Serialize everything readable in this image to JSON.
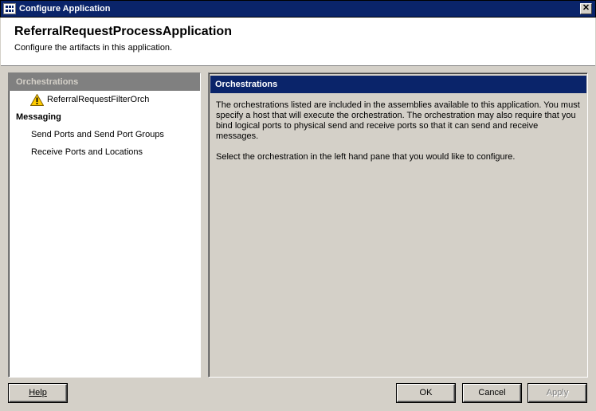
{
  "window": {
    "title": "Configure Application",
    "close_glyph": "✕"
  },
  "header": {
    "title": "ReferralRequestProcessApplication",
    "subtitle": "Configure the artifacts in this application."
  },
  "left_pane": {
    "section_header": "Orchestrations",
    "orchestration_item": "ReferralRequestFilterOrch",
    "orchestration_icon": "warning-icon",
    "group_label": "Messaging",
    "sub_items": [
      "Send Ports and Send Port Groups",
      "Receive Ports and Locations"
    ]
  },
  "right_pane": {
    "header": "Orchestrations",
    "paragraph1": "The orchestrations listed are included in the assemblies available to this application. You must specify a host that will execute the orchestration. The orchestration may also require that you bind logical ports to physical send and receive ports so that it can send and receive messages.",
    "paragraph2": "Select the orchestration in the left hand pane that you would like to configure."
  },
  "buttons": {
    "help": "Help",
    "ok": "OK",
    "cancel": "Cancel",
    "apply": "Apply"
  },
  "colors": {
    "title_bar": "#0a246a",
    "dialog_bg": "#d4d0c8",
    "left_header_bg": "#808080",
    "warning": "#ffcc00"
  }
}
